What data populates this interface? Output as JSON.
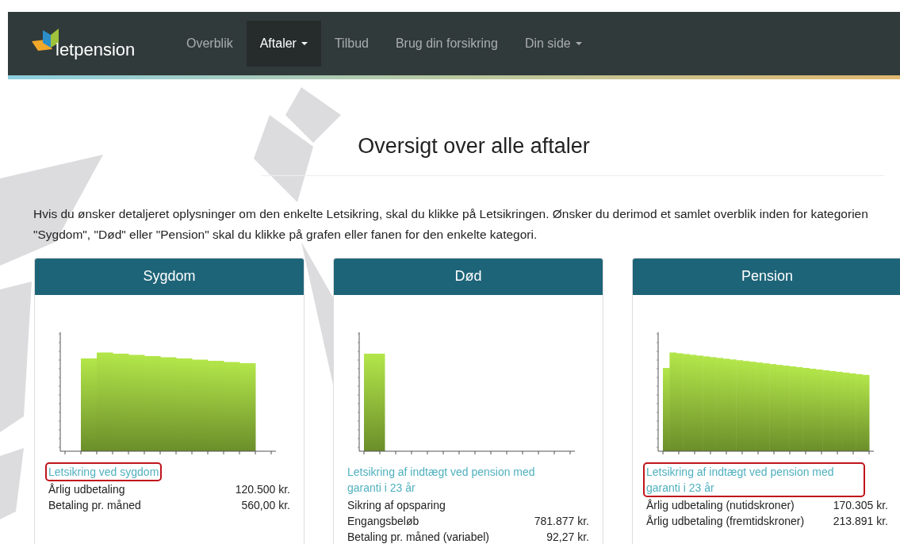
{
  "navbar": {
    "logo_text": "letpension",
    "items": [
      {
        "label": "Overblik",
        "selected": false,
        "dropdown": false
      },
      {
        "label": "Aftaler",
        "selected": true,
        "dropdown": true
      },
      {
        "label": "Tilbud",
        "selected": false,
        "dropdown": false
      },
      {
        "label": "Brug din forsikring",
        "selected": false,
        "dropdown": false
      },
      {
        "label": "Din side",
        "selected": false,
        "dropdown": true
      }
    ]
  },
  "page_title": "Oversigt over alle aftaler",
  "intro": "Hvis du ønsker detaljeret oplysninger om den enkelte Letsikring, skal du klikke på Letsikringen. Ønsker du derimod et samlet overblik inden for kategorien \"Sygdom\", \"Død\" eller \"Pension\" skal du klikke på grafen eller fanen for den enkelte kategori.",
  "cards": [
    {
      "title": "Sygdom",
      "kind": "plateau",
      "link": "Letsikring ved sygdom",
      "highlighted": true,
      "rows": [
        {
          "label": "Årlig udbetaling",
          "value": "120.500 kr."
        },
        {
          "label": "Betaling pr. måned",
          "value": "560,00 kr."
        }
      ]
    },
    {
      "title": "Død",
      "kind": "single",
      "link": "Letsikring af indtægt ved pension med garanti i 23 år",
      "highlighted": false,
      "rows": [
        {
          "label": "Sikring af opsparing"
        },
        {
          "label": "Engangsbeløb",
          "value": "781.877 kr."
        },
        {
          "label": "Betaling pr. måned (variabel)",
          "value": "92,27 kr."
        }
      ]
    },
    {
      "title": "Pension",
      "kind": "declining",
      "link": "Letsikring af indtægt ved pension med garanti i 23 år",
      "highlighted": true,
      "rows": [
        {
          "label": "Årlig udbetaling (nutidskroner)",
          "value": "170.305 kr."
        },
        {
          "label": "Årlig udbetaling (fremtidskroner)",
          "value": "213.891 kr."
        }
      ]
    }
  ]
}
